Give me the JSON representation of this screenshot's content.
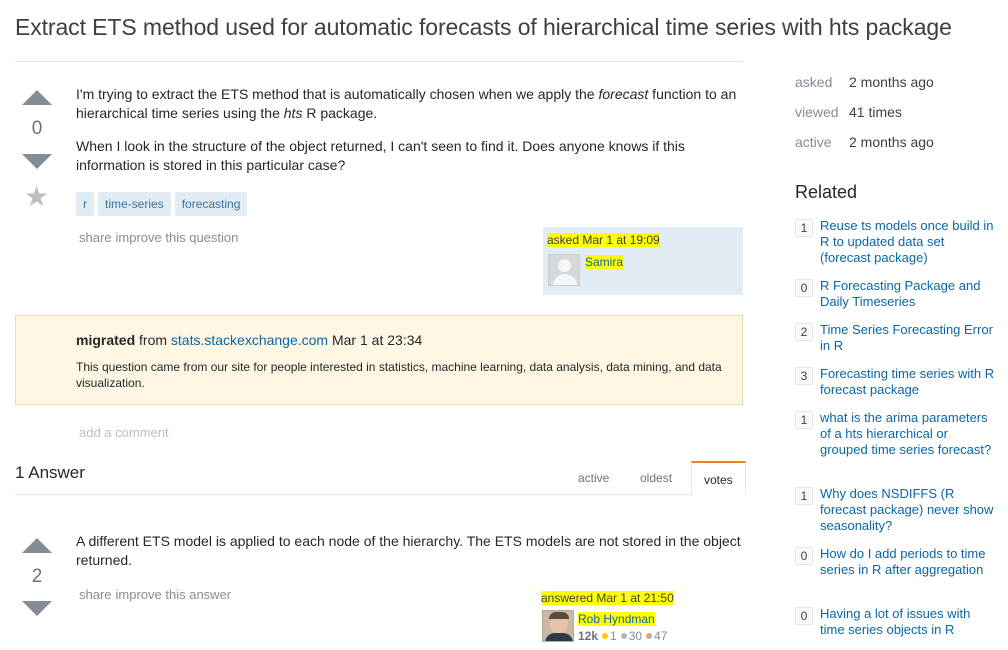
{
  "question": {
    "title": "Extract ETS method used for automatic forecasts of hierarchical time series with hts package",
    "votes": "0",
    "body_p1": "I'm trying to extract the ETS method that is automatically chosen when we apply the forecast function to an hierarchical time series using the hts R package.",
    "body_p1_parts": {
      "a": "I'm trying to extract the ETS method that is automatically chosen when we apply the ",
      "em1": "forecast",
      "b": " function to an hierarchical time series using the ",
      "em2": "hts",
      "c": " R package."
    },
    "body_p2": "When I look in the structure of the object returned, I can't seen to find it. Does anyone knows if this information is stored in this particular case?",
    "tags": [
      "r",
      "time-series",
      "forecasting"
    ],
    "share_label": "share",
    "improve_label": "improve this question",
    "asked_label": "asked Mar 1 at 19:09",
    "owner_name": "Samira"
  },
  "migrated": {
    "label": "migrated",
    "from": "from",
    "site": "stats.stackexchange.com",
    "date": "Mar 1 at 23:34",
    "description": "This question came from our site for people interested in statistics, machine learning, data analysis, data mining, and data visualization."
  },
  "add_comment": "add a comment",
  "answers_header": {
    "count_label": "1 Answer",
    "tabs": [
      "active",
      "oldest",
      "votes"
    ],
    "active_tab": "votes"
  },
  "answer": {
    "votes": "2",
    "body": "A different ETS model is applied to each node of the hierarchy. The ETS models are not stored in the object returned.",
    "share_label": "share",
    "improve_label": "improve this answer",
    "answered_label": "answered Mar 1 at 21:50",
    "user_name": "Rob Hyndman",
    "reputation": "12k",
    "gold": "1",
    "silver": "30",
    "bronze": "47"
  },
  "sidebar": {
    "stats": [
      {
        "label": "asked",
        "value": "2 months ago"
      },
      {
        "label": "viewed",
        "value": "41 times"
      },
      {
        "label": "active",
        "value": "2 months ago"
      }
    ],
    "related_title": "Related",
    "related": [
      {
        "count": "1",
        "title": "Reuse ts models once build in R to updated data set (forecast package)"
      },
      {
        "count": "0",
        "title": "R Forecasting Package and Daily Timeseries"
      },
      {
        "count": "2",
        "title": "Time Series Forecasting Error in R"
      },
      {
        "count": "3",
        "title": "Forecasting time series with R forecast package"
      },
      {
        "count": "1",
        "title": "what is the arima parameters of a hts hierarchical or grouped time series forecast?"
      },
      {
        "count": "1",
        "title": "Why does NSDIFFS (R forecast package) never show seasonality?"
      },
      {
        "count": "0",
        "title": "How do I add periods to time series in R after aggregation"
      },
      {
        "count": "0",
        "title": "Having a lot of issues with time series objects in R"
      }
    ]
  },
  "colors": {
    "link": "#0c65a5",
    "highlight": "#ffff00",
    "tag_bg": "#e1ecf4",
    "migrated_bg": "#fdf7e3",
    "accent_tab": "#f48024",
    "gold": "#ffcc01",
    "silver": "#b4b8bc",
    "bronze": "#d1a684"
  }
}
